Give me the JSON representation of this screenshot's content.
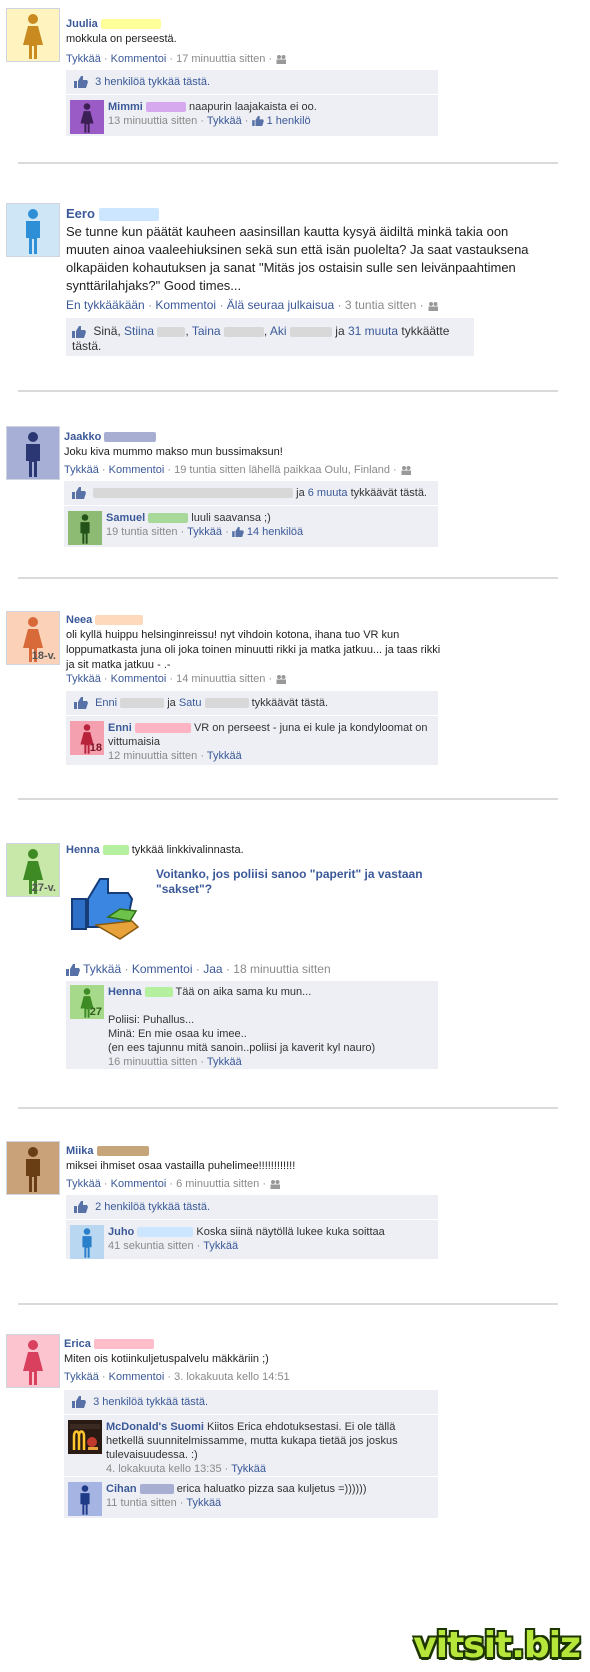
{
  "posts": [
    {
      "name": "Juulia",
      "text": "mokkula on perseestä.",
      "like": "Tykkää",
      "comment": "Kommentoi",
      "time": "17 minuuttia sitten",
      "likes_text": "3 henkilöä tykkää tästä.",
      "c1_name": "Mimmi",
      "c1_text": "naapurin laajakaista ei oo.",
      "c1_time": "13 minuuttia sitten",
      "c1_like": "Tykkää",
      "c1_count": "1 henkilö"
    },
    {
      "name": "Eero",
      "text": "Se tunne kun päätät kauheen aasinsillan kautta kysyä äidiltä minkä takia oon muuten ainoa vaaleehiuksinen sekä sun että isän puolelta? Ja saat vastauksena olkapäiden kohautuksen ja sanat \"Mitäs jos ostaisin sulle sen leivänpaahtimen synttärilahjaks?\" Good times...",
      "unlike": "En tykkääkään",
      "comment": "Kommentoi",
      "unfollow": "Älä seuraa julkaisua",
      "time": "3 tuntia sitten",
      "likes_you": "Sinä,",
      "liker1": "Stiina",
      "liker2": "Taina",
      "liker3": "Aki",
      "and": "ja",
      "more": "31 muuta",
      "likes_tail": "tykkäätte tästä."
    },
    {
      "name": "Jaakko",
      "text": "Joku kiva mummo makso mun bussimaksun!",
      "like": "Tykkää",
      "comment": "Kommentoi",
      "time": "19 tuntia sitten lähellä paikkaa Oulu, Finland",
      "likes_and": "ja",
      "likes_more": "6 muuta",
      "likes_tail": "tykkäävät tästä.",
      "c1_name": "Samuel",
      "c1_text": "luuli saavansa ;)",
      "c1_time": "19 tuntia sitten",
      "c1_like": "Tykkää",
      "c1_count": "14 henkilöä"
    },
    {
      "name": "Neea",
      "age": "18-v.",
      "text": "oli kyllä huippu helsinginreissu! nyt vihdoin kotona, ihana tuo VR kun loppumatkasta juna oli joka toinen minuutti rikki ja matka jatkuu... ja taas rikki ja sit matka jatkuu - .-",
      "like": "Tykkää",
      "comment": "Kommentoi",
      "time": "14 minuuttia sitten",
      "liker1": "Enni",
      "and": "ja",
      "liker2": "Satu",
      "likes_tail": "tykkäävät tästä.",
      "c1_name": "Enni",
      "c1_age": "18",
      "c1_text": "VR on perseest - juna ei kule ja kondyloomat on vittumaisia",
      "c1_time": "12 minuuttia sitten",
      "c1_like": "Tykkää"
    },
    {
      "name": "Henna",
      "age": "27-v.",
      "action": "tykkää linkkivalinnasta.",
      "link_title": "Voitanko, jos poliisi sanoo \"paperit\" ja vastaan \"sakset\"?",
      "like": "Tykkää",
      "comment": "Kommentoi",
      "share": "Jaa",
      "time": "18 minuuttia sitten",
      "c1_name": "Henna",
      "c1_age": "27",
      "c1_line1": "Tää on aika sama ku mun...",
      "c1_line2": "Poliisi: Puhallus...",
      "c1_line3": "Minä: En mie osaa ku imee..",
      "c1_line4": "(en ees tajunnu mitä sanoin..poliisi ja kaverit kyl nauro)",
      "c1_time": "16 minuuttia sitten",
      "c1_like": "Tykkää"
    },
    {
      "name": "Miika",
      "text": "miksei ihmiset osaa vastailla puhelimee!!!!!!!!!!!!",
      "like": "Tykkää",
      "comment": "Kommentoi",
      "time": "6 minuuttia sitten",
      "likes_text": "2 henkilöä tykkää tästä.",
      "c1_name": "Juho",
      "c1_text": "Koska siinä näytöllä lukee kuka soittaa",
      "c1_time": "41 sekuntia sitten",
      "c1_like": "Tykkää"
    },
    {
      "name": "Erica",
      "text": "Miten ois kotiinkuljetuspalvelu mäkkäriin ;)",
      "like": "Tykkää",
      "comment": "Kommentoi",
      "time": "3. lokakuuta kello 14:51",
      "likes_text": "3 henkilöä tykkää tästä.",
      "c1_name": "McDonald's Suomi",
      "c1_text": "Kiitos Erica ehdotuksestasi. Ei ole tällä hetkellä suunnitelmissamme, mutta kukapa tietää jos joskus tulevaisuudessa. :)",
      "c1_time": "4. lokakuuta kello 13:35",
      "c1_like": "Tykkää",
      "c2_name": "Cihan",
      "c2_text": "erica haluatko pizza saa kuljetus =))))))",
      "c2_time": "11 tuntia sitten",
      "c2_like": "Tykkää"
    }
  ],
  "dot": "·",
  "watermark": "vitsit.biz",
  "colors": {
    "link": "#3b5998",
    "juulia": "#ffe27a",
    "mimmi": "#9b5bc6",
    "eero": "#3a9ad9",
    "jaakko": "#3d4f9e",
    "samuel": "#4e8a3a",
    "neea": "#e07a4a",
    "enni": "#d94860",
    "henna": "#5aa23a",
    "miika": "#8a5a28",
    "juho": "#3a8ad0",
    "erica": "#e05a78",
    "cihan": "#2e4f9e"
  }
}
